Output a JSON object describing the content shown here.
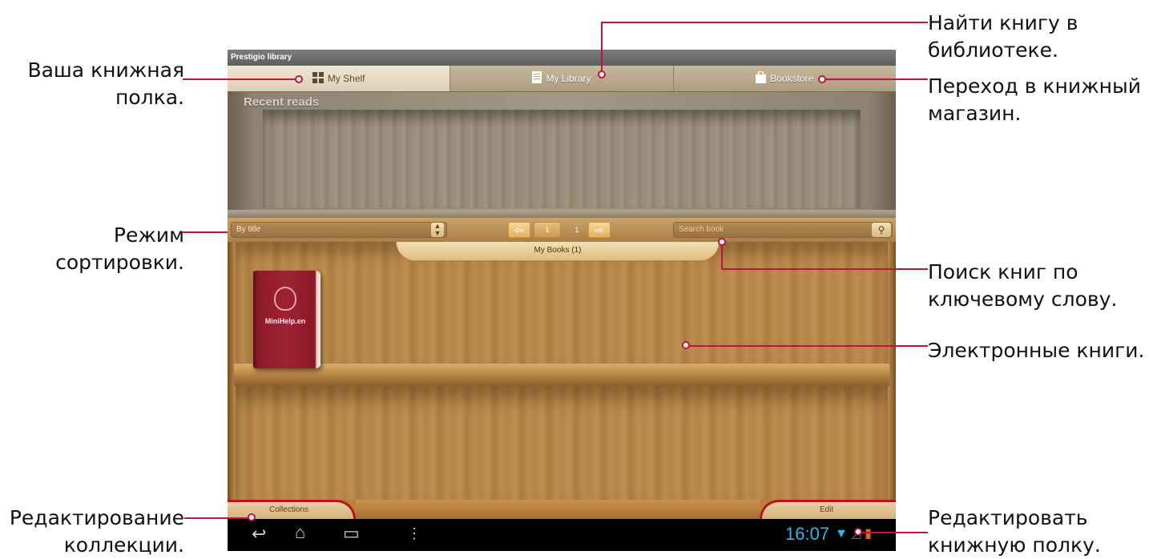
{
  "app": {
    "title": "Prestigio library"
  },
  "tabs": [
    {
      "label": "My Shelf",
      "icon": "grid-icon",
      "active": true
    },
    {
      "label": "My Library",
      "icon": "list-icon",
      "active": false
    },
    {
      "label": "Bookstore",
      "icon": "bag-icon",
      "active": false
    }
  ],
  "recent": {
    "title": "Recent reads"
  },
  "toolbar": {
    "sort_value": "By title",
    "page_current": "1",
    "page_total": "1",
    "search_placeholder": "Search book"
  },
  "shelf": {
    "label": "My Books (1)",
    "books": [
      {
        "title": "MiniHelp.en"
      }
    ]
  },
  "bottom": {
    "collections": "Collections",
    "edit": "Edit"
  },
  "status": {
    "time": "16:07"
  },
  "callouts": {
    "my_shelf": "Ваша книжная полка.",
    "sort_mode": "Режим сортировки.",
    "edit_collections": "Редактирование коллекции.",
    "find_in_library": "Найти книгу в библиотеке.",
    "go_to_store": "Переход в книжный магазин.",
    "search_keyword": "Поиск книг по ключевому слову.",
    "ebooks": "Электронные книги.",
    "edit_shelf": "Редактировать книжную полку."
  },
  "colors": {
    "callout_line": "#c0143c",
    "accent_blue": "#33b5e5"
  }
}
